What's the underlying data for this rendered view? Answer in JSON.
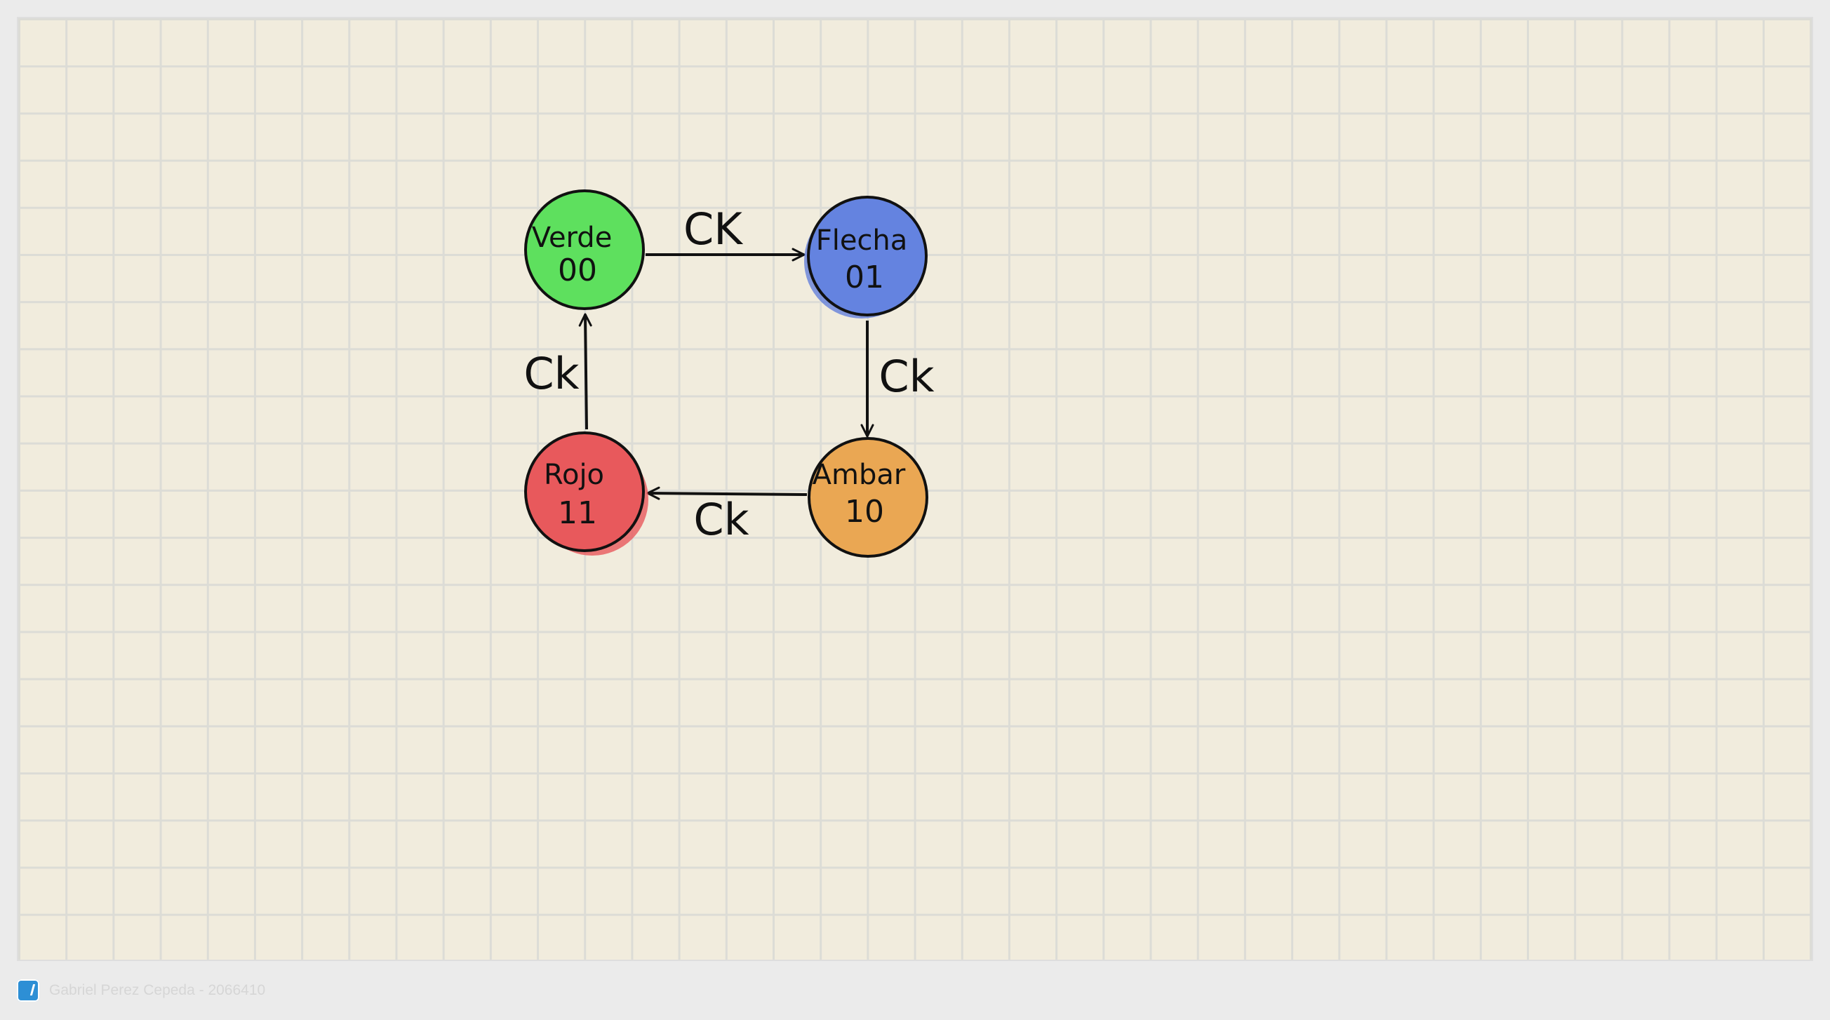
{
  "diagram": {
    "states": [
      {
        "id": "verde",
        "name": "Verde",
        "code": "00",
        "color": "#5ee05e"
      },
      {
        "id": "flecha",
        "name": "Flecha",
        "code": "01",
        "color": "#6483e0"
      },
      {
        "id": "ambar",
        "name": "Ambar",
        "code": "10",
        "color": "#eaa753"
      },
      {
        "id": "rojo",
        "name": "Rojo",
        "code": "11",
        "color": "#e8595c"
      }
    ],
    "transitions": [
      {
        "from": "verde",
        "to": "flecha",
        "label": "CK"
      },
      {
        "from": "flecha",
        "to": "ambar",
        "label": "Ck"
      },
      {
        "from": "ambar",
        "to": "rojo",
        "label": "Ck"
      },
      {
        "from": "rojo",
        "to": "verde",
        "label": "Ck"
      }
    ]
  },
  "footer": {
    "app_icon": "whiteboard-app-icon",
    "text": "Gabriel Perez Cepeda - 2066410"
  }
}
